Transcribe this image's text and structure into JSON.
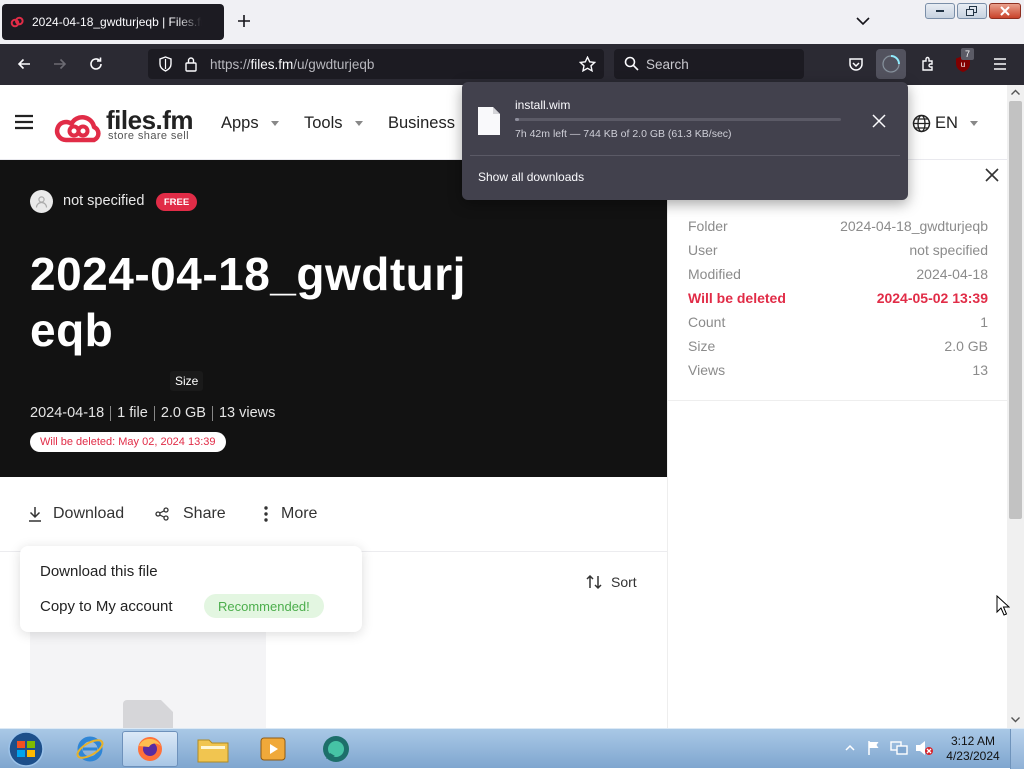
{
  "browser": {
    "tab_title": "2024-04-18_gwdturjeqb | Files.fm",
    "url_prefix": "https://",
    "url_domain": "files.fm",
    "url_path": "/u/gwdturjeqb",
    "search_placeholder": "Search",
    "extension_badge": "7",
    "icons": [
      "files-fm-favicon",
      "new-tab-icon",
      "list-tabs-icon",
      "back-icon",
      "forward-icon",
      "reload-icon",
      "shield-icon",
      "lock-icon",
      "bookmark-star-icon",
      "search-icon",
      "pocket-icon",
      "downloads-icon",
      "extensions-icon",
      "ublock-icon",
      "menu-icon"
    ]
  },
  "downloads_panel": {
    "filename": "install.wim",
    "status": "7h 42m left — 744 KB of 2.0 GB (61.3 KB/sec)",
    "progress_fraction": 0.0004,
    "show_all": "Show all downloads"
  },
  "site": {
    "logo_name": "files.fm",
    "logo_tagline": "store share sell",
    "nav": [
      {
        "label": "Apps"
      },
      {
        "label": "Tools"
      },
      {
        "label": "Business"
      }
    ],
    "language": "EN",
    "accent_color": "#e12c47"
  },
  "hero": {
    "user": "not specified",
    "badge": "FREE",
    "title": "2024-04-18_gwdturjeqb",
    "tooltip": "Size",
    "date": "2024-04-18",
    "files": "1 file",
    "size": "2.0 GB",
    "views": "13 views",
    "deletion_notice": "Will be deleted: May 02, 2024 13:39"
  },
  "actions": {
    "download": "Download",
    "share": "Share",
    "more": "More",
    "sort": "Sort"
  },
  "dropdown": {
    "download_file": "Download this file",
    "copy_account": "Copy to My account",
    "recommended": "Recommended!"
  },
  "details": [
    {
      "key": "Folder",
      "value": "2024-04-18_gwdturjeqb"
    },
    {
      "key": "User",
      "value": "not specified"
    },
    {
      "key": "Modified",
      "value": "2024-04-18"
    },
    {
      "key": "Will be deleted",
      "value": "2024-05-02 13:39"
    },
    {
      "key": "Count",
      "value": "1"
    },
    {
      "key": "Size",
      "value": "2.0 GB"
    },
    {
      "key": "Views",
      "value": "13"
    }
  ],
  "taskbar": {
    "time": "3:12 AM",
    "date": "4/23/2024",
    "apps": [
      "internet-explorer-icon",
      "firefox-icon",
      "file-explorer-icon",
      "media-player-icon",
      "chat-app-icon"
    ]
  }
}
